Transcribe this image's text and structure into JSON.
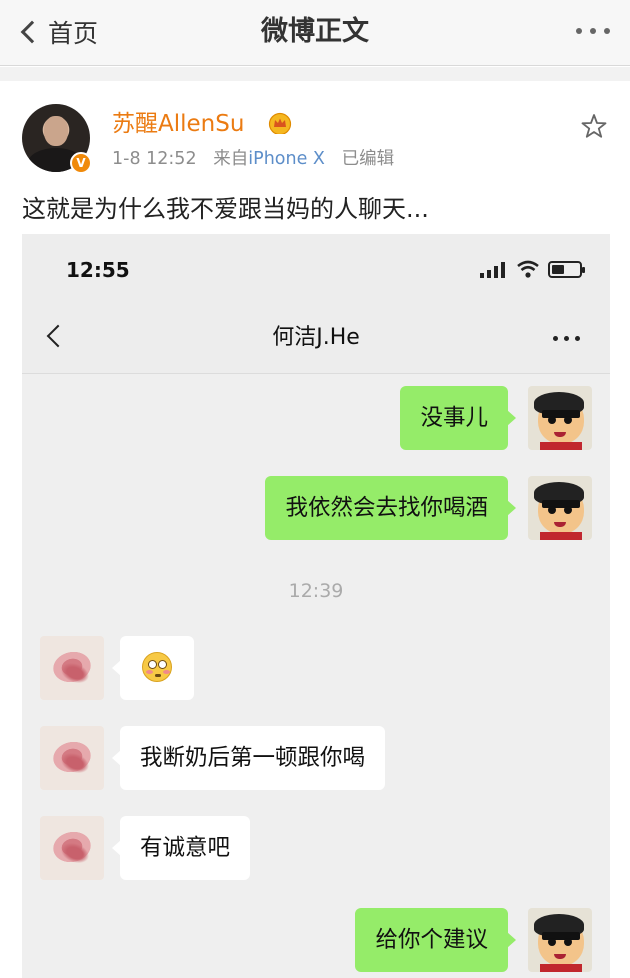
{
  "topbar": {
    "back_label": "首页",
    "title": "微博正文"
  },
  "post": {
    "author": "苏醒AllenSu",
    "verified_badge": "V",
    "time": "1-8 12:52",
    "source_prefix": "来自",
    "source": "iPhone X",
    "edited": "已编辑",
    "text": "这就是为什么我不爱跟当妈的人聊天..."
  },
  "chat": {
    "status_time": "12:55",
    "contact_name": "何洁J.He",
    "timestamp": "12:39",
    "messages": [
      {
        "from": "me",
        "text": "没事儿"
      },
      {
        "from": "me",
        "text": "我依然会去找你喝酒"
      },
      {
        "from": "them",
        "text": "",
        "emoji": "flushed-face"
      },
      {
        "from": "them",
        "text": "我断奶后第一顿跟你喝"
      },
      {
        "from": "them",
        "text": "有诚意吧"
      },
      {
        "from": "me",
        "text": "给你个建议"
      }
    ]
  },
  "colors": {
    "username": "#eb7b12",
    "source_link": "#5d8ec9",
    "my_bubble": "#95ec69",
    "their_bubble": "#ffffff"
  }
}
